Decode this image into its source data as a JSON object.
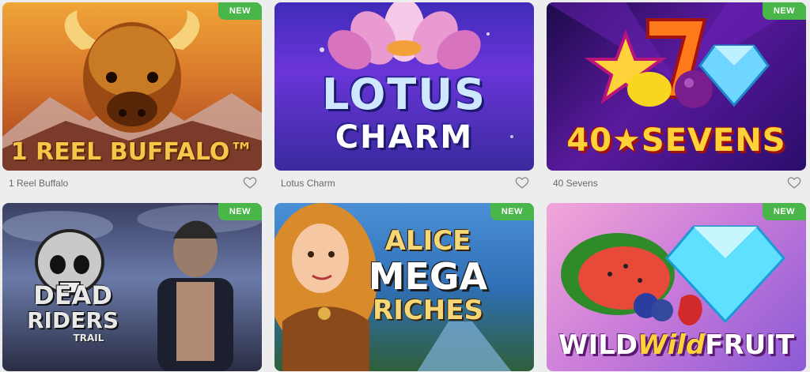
{
  "badge_label": "NEW",
  "games": [
    {
      "name": "1 Reel Buffalo",
      "artwork_title": "1 REEL BUFFALO™",
      "is_new": true
    },
    {
      "name": "Lotus Charm",
      "artwork_title_line1": "LOTUS",
      "artwork_title_line2": "CHARM",
      "is_new": false
    },
    {
      "name": "40 Sevens",
      "artwork_title": "40★SEVENS",
      "is_new": true
    },
    {
      "name": "Dead Riders Trail",
      "artwork_title_line1": "DEAD",
      "artwork_title_line2": "RIDERS",
      "artwork_title_line3": "TRAIL",
      "is_new": true
    },
    {
      "name": "Alice Mega Riches",
      "artwork_title_line1": "ALICE",
      "artwork_title_line2": "MEGA",
      "artwork_title_line3": "RICHES",
      "is_new": true
    },
    {
      "name": "Wild Wild Fruit",
      "artwork_title_part1": "WILD",
      "artwork_title_part2": "Wild",
      "artwork_title_part3": "FRUIT",
      "is_new": true
    }
  ],
  "colors": {
    "page_bg": "#ededed",
    "new_badge": "#49b649",
    "name_text": "#6a6a6a"
  }
}
